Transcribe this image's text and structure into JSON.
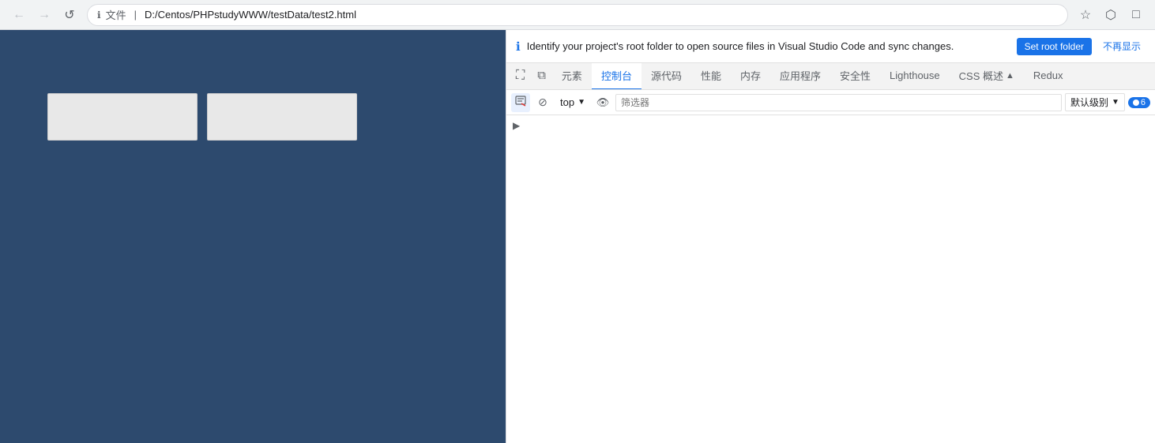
{
  "browser": {
    "back_button": "←",
    "forward_button": "→",
    "reload_button": "↺",
    "info_label": "文件",
    "address": "D:/Centos/PHPstudyWWW/testData/test2.html",
    "bookmark_icon": "☆",
    "extensions_icon": "⬡",
    "maximize_icon": "□"
  },
  "devtools": {
    "info_banner": {
      "text": "Identify your project's root folder to open source files in Visual Studio Code and sync changes.",
      "set_root_label": "Set root folder",
      "dismiss_label": "不再显示"
    },
    "tabs": [
      {
        "id": "screen",
        "label": "",
        "icon": "⛶",
        "active": false
      },
      {
        "id": "copy",
        "label": "",
        "icon": "⧉",
        "active": false
      },
      {
        "id": "elements",
        "label": "元素",
        "active": false
      },
      {
        "id": "console",
        "label": "控制台",
        "active": true
      },
      {
        "id": "sources",
        "label": "源代码",
        "active": false
      },
      {
        "id": "performance",
        "label": "性能",
        "active": false
      },
      {
        "id": "memory",
        "label": "内存",
        "active": false
      },
      {
        "id": "application",
        "label": "应用程序",
        "active": false
      },
      {
        "id": "security",
        "label": "安全性",
        "active": false
      },
      {
        "id": "lighthouse",
        "label": "Lighthouse",
        "active": false
      },
      {
        "id": "css-overview",
        "label": "CSS 概述",
        "active": false
      },
      {
        "id": "redux",
        "label": "Redux",
        "active": false
      }
    ],
    "console_toolbar": {
      "clear_icon": "🚫",
      "block_icon": "⊘",
      "context_value": "top",
      "eye_icon": "👁",
      "filter_placeholder": "筛选器",
      "level_label": "默认级别",
      "error_count": "6"
    }
  },
  "webpage": {
    "box1_label": "",
    "box2_label": ""
  }
}
